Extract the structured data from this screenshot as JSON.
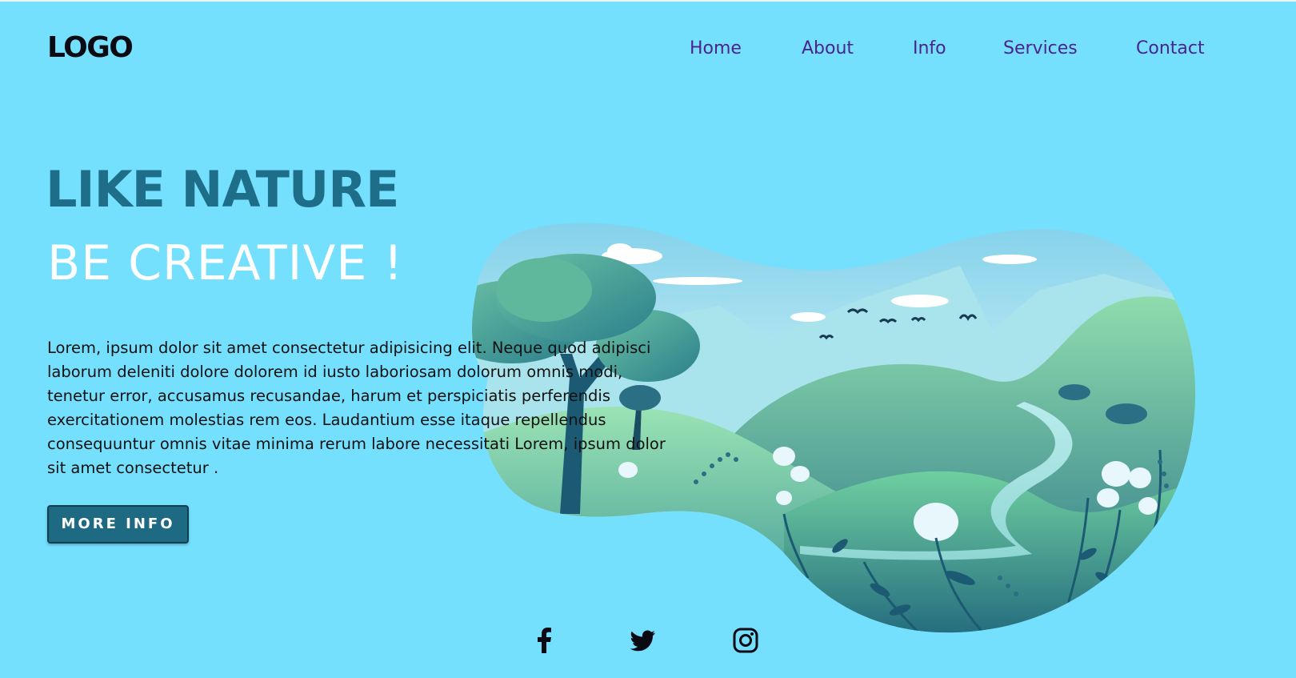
{
  "header": {
    "logo": "LOGO",
    "nav": [
      "Home",
      "About",
      "Info",
      "Services",
      "Contact"
    ]
  },
  "hero": {
    "title_line1": "LIKE NATURE",
    "title_line2": "BE CREATIVE !",
    "paragraph": "Lorem, ipsum dolor sit amet consectetur adipisicing elit. Neque quod adipisci laborum deleniti dolore dolorem id iusto laboriosam dolorum omnis modi, tenetur error, accusamus recusandae, harum et perspiciatis perferendis exercitationem molestias rem eos. Laudantium esse itaque repellendus consequuntur omnis vitae minima rerum labore necessitati Lorem, ipsum dolor sit amet consectetur .",
    "button_label": "MORE INFO"
  },
  "social": [
    {
      "icon": "facebook-icon"
    },
    {
      "icon": "twitter-icon"
    },
    {
      "icon": "instagram-icon"
    }
  ],
  "colors": {
    "background": "#74e0fe",
    "title_primary": "#1f6e89",
    "title_secondary": "#ffffff",
    "nav_link": "#4b2391",
    "button": "#1f6a83"
  }
}
